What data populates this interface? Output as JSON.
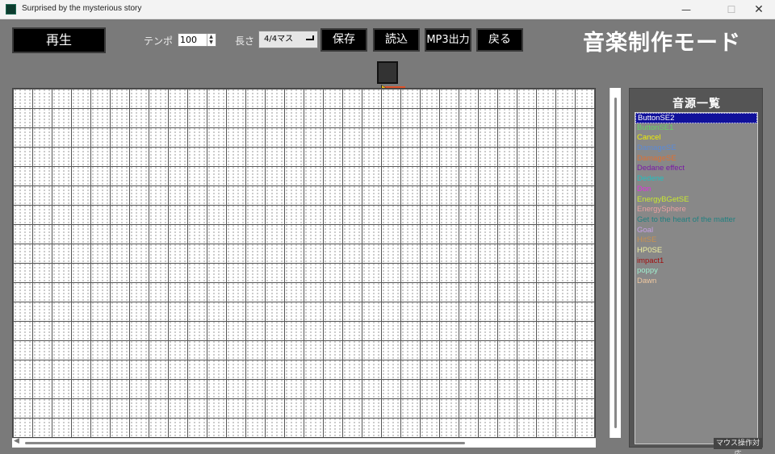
{
  "window": {
    "title": "Surprised by the mysterious story",
    "minimize_glyph": "—",
    "maximize_glyph": "☐",
    "close_glyph": "✕"
  },
  "toolbar": {
    "play_label": "再生",
    "tempo_label": "テンポ",
    "tempo_value": "100",
    "length_label": "長さ",
    "length_value": "4/4マス",
    "save_label": "保存",
    "load_label": "読込",
    "mp3_label": "MP3出力",
    "back_label": "戻る"
  },
  "mode_title": "音楽制作モード",
  "sound_panel": {
    "title": "音源一覧",
    "items": [
      {
        "label": "ButtonSE2",
        "color": "#ffffff",
        "selected": true
      },
      {
        "label": "ButtonSE1",
        "color": "#66d066",
        "selected": false
      },
      {
        "label": "Cancel",
        "color": "#f0f000",
        "selected": false
      },
      {
        "label": "DamageSE",
        "color": "#5a8ad8",
        "selected": false
      },
      {
        "label": "DamageSE",
        "color": "#e07030",
        "selected": false
      },
      {
        "label": "Dedane effect",
        "color": "#7a1aa8",
        "selected": false
      },
      {
        "label": "Dedene",
        "color": "#20c0c0",
        "selected": false
      },
      {
        "label": "Don",
        "color": "#e030e0",
        "selected": false
      },
      {
        "label": "EnergyBGetSE",
        "color": "#c8e830",
        "selected": false
      },
      {
        "label": "EnergySphere",
        "color": "#e8a0a0",
        "selected": false
      },
      {
        "label": "Get to the heart of the matter",
        "color": "#208080",
        "selected": false
      },
      {
        "label": "Goal",
        "color": "#c8a0e8",
        "selected": false
      },
      {
        "label": "HitSE",
        "color": "#c89050",
        "selected": false
      },
      {
        "label": "HP0SE",
        "color": "#f0f0a0",
        "selected": false
      },
      {
        "label": "impact1",
        "color": "#a01010",
        "selected": false
      },
      {
        "label": "poppy",
        "color": "#a0f0d0",
        "selected": false
      },
      {
        "label": "Dawn",
        "color": "#f0c8a0",
        "selected": false
      }
    ]
  },
  "status": {
    "mouse_badge": "マウス操作対応"
  }
}
